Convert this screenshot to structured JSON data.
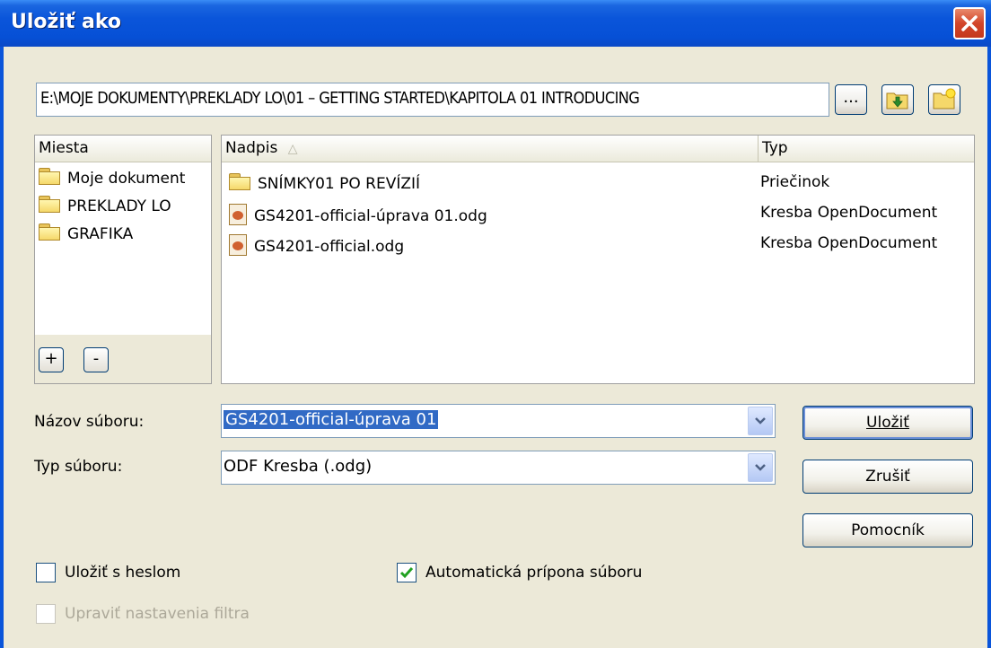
{
  "window": {
    "title": "Uložiť ako",
    "close_icon": "close-icon"
  },
  "path": {
    "value": "E:\\MOJE DOKUMENTY\\PREKLADY LO\\01 – GETTING STARTED\\KAPITOLA 01 INTRODUCING",
    "browse_label": "...",
    "buttons": [
      "go-up-folder-icon",
      "new-folder-icon"
    ]
  },
  "places": {
    "header": "Miesta",
    "items": [
      {
        "label": "Moje dokument",
        "icon": "folder-icon"
      },
      {
        "label": "PREKLADY LO",
        "icon": "folder-icon"
      },
      {
        "label": "GRAFIKA",
        "icon": "folder-icon"
      }
    ],
    "add_label": "+",
    "remove_label": "-"
  },
  "files": {
    "columns": {
      "name": "Nadpis",
      "type": "Typ"
    },
    "rows": [
      {
        "name": "SNÍMKY01 PO REVÍZIÍ",
        "type": "Priečinok",
        "icon": "folder-icon"
      },
      {
        "name": "GS4201-official-úprava 01.odg",
        "type": "Kresba OpenDocument",
        "icon": "odg-file-icon"
      },
      {
        "name": "GS4201-official.odg",
        "type": "Kresba OpenDocument",
        "icon": "odg-file-icon"
      }
    ]
  },
  "form": {
    "filename_label": "Názov súboru:",
    "filename_value": "GS4201-official-úprava 01",
    "filetype_label": "Typ súboru:",
    "filetype_value": "ODF Kresba (.odg)"
  },
  "buttons": {
    "save": "Uložiť",
    "cancel": "Zrušiť",
    "help": "Pomocník"
  },
  "options": {
    "password_label": "Uložiť s heslom",
    "password_checked": false,
    "auto_ext_label": "Automatická prípona súboru",
    "auto_ext_checked": true,
    "filter_label": "Upraviť nastavenia filtra",
    "filter_enabled": false
  },
  "colors": {
    "titlebar": "#0a55da",
    "dialog_bg": "#ece9d8",
    "selection": "#316ac5"
  }
}
